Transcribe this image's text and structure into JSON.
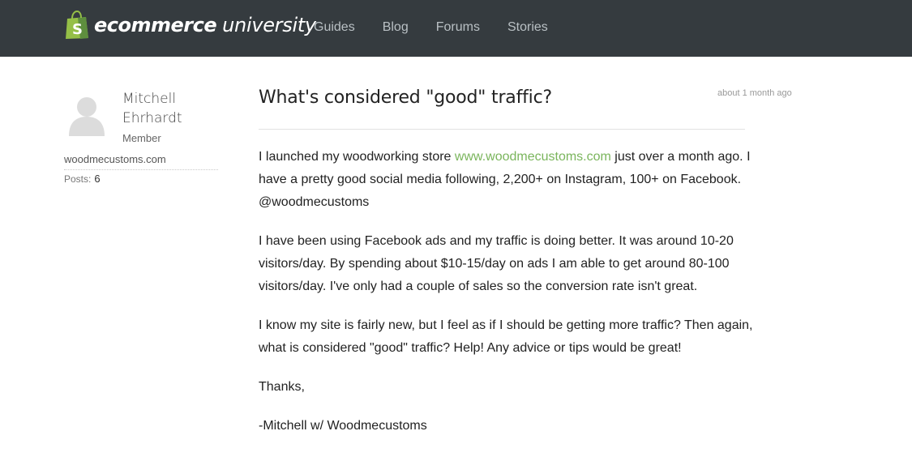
{
  "header": {
    "logo_bold": "ecommerce",
    "logo_light": "university",
    "logo_bag_letter": "S",
    "nav": [
      "Guides",
      "Blog",
      "Forums",
      "Stories"
    ]
  },
  "author": {
    "name": "Mitchell Ehrhardt",
    "role": "Member",
    "site": "woodmecustoms.com",
    "posts_label": "Posts:",
    "posts_count": "6"
  },
  "post": {
    "title": "What's considered \"good\" traffic?",
    "time": "about 1 month ago",
    "p1_before": "I launched my woodworking store ",
    "p1_link": "www.woodmecustoms.com",
    "p1_after": " just over a month ago. I have a pretty good social media following, 2,200+ on Instagram, 100+ on Facebook. @woodmecustoms",
    "p2": "I have been using Facebook ads and my traffic is doing better. It was around 10-20 visitors/day. By spending about $10-15/day on ads I am able to get around 80-100 visitors/day. I've only had a couple of sales so the conversion rate isn't great.",
    "p3": "I know my site is fairly new, but I feel as if I should be getting more traffic? Then again, what is considered \"good\" traffic? Help! Any advice or tips would be great!",
    "p4": "Thanks,",
    "p5": "-Mitchell w/ Woodmecustoms"
  },
  "colors": {
    "topbar": "#353b3f",
    "nav_text": "#b9c0c4",
    "link_green": "#7ab55c",
    "bag_green": "#95bf47"
  }
}
